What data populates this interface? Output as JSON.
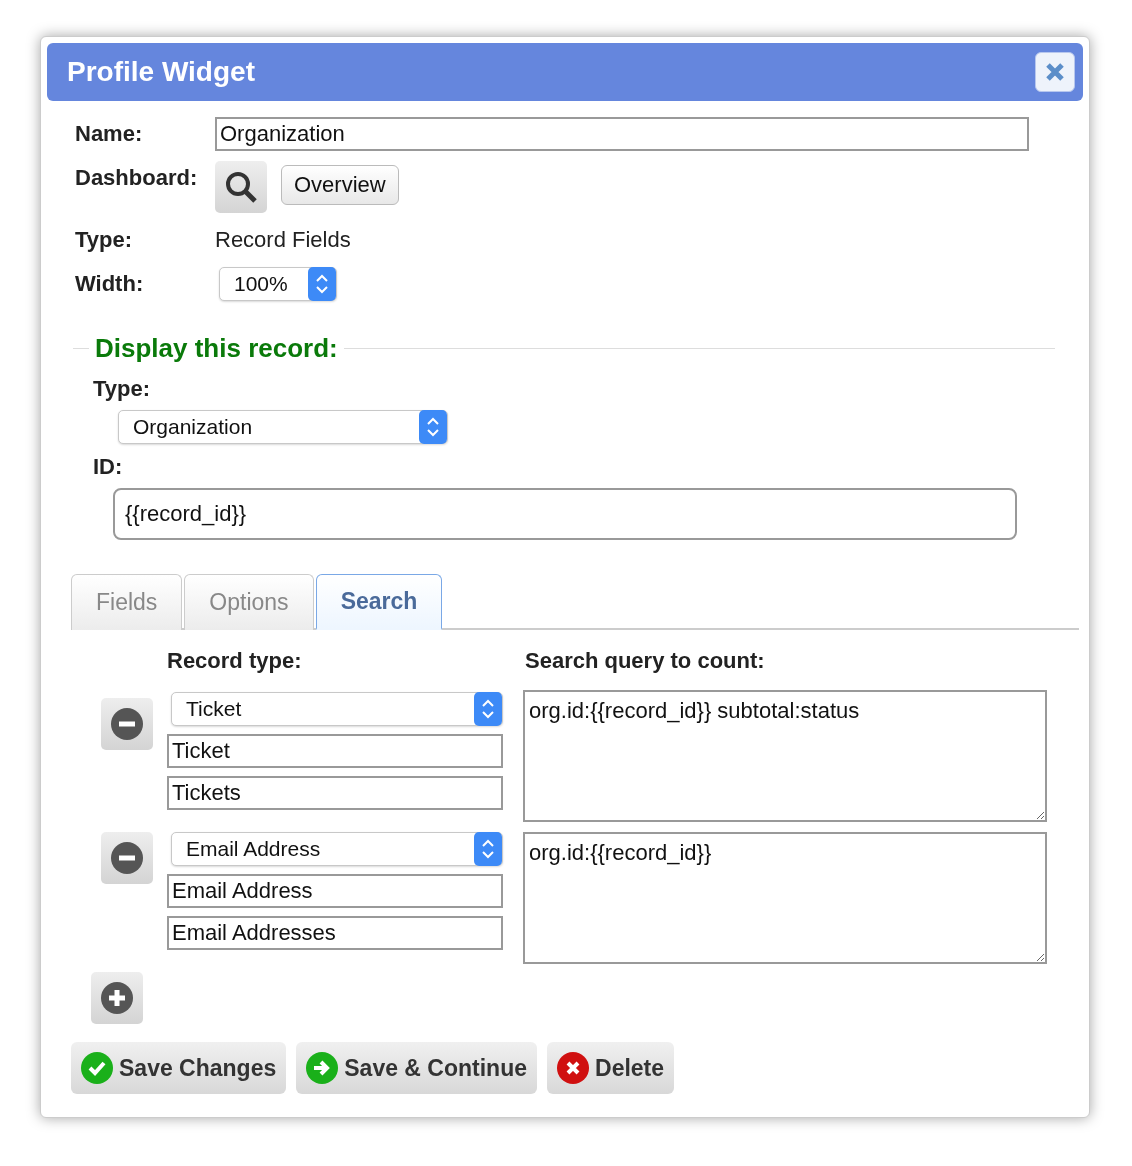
{
  "window": {
    "title": "Profile Widget"
  },
  "form": {
    "name_label": "Name:",
    "name_value": "Organization",
    "dashboard_label": "Dashboard:",
    "dashboard_button": "Overview",
    "type_label": "Type:",
    "type_value": "Record Fields",
    "width_label": "Width:",
    "width_value": "100%"
  },
  "display": {
    "legend": "Display this record:",
    "type_label": "Type:",
    "type_value": "Organization",
    "id_label": "ID:",
    "id_value": "{{record_id}}"
  },
  "tabs": [
    {
      "label": "Fields",
      "selected": false
    },
    {
      "label": "Options",
      "selected": false
    },
    {
      "label": "Search",
      "selected": true
    }
  ],
  "search": {
    "record_type_heading": "Record type:",
    "query_heading": "Search query to count:",
    "rows": [
      {
        "type": "Ticket",
        "singular": "Ticket",
        "plural": "Tickets",
        "query": "org.id:{{record_id}} subtotal:status"
      },
      {
        "type": "Email Address",
        "singular": "Email Address",
        "plural": "Email Addresses",
        "query": "org.id:{{record_id}}"
      }
    ]
  },
  "buttons": [
    {
      "label": "Save Changes",
      "kind": "save"
    },
    {
      "label": "Save & Continue",
      "kind": "continue"
    },
    {
      "label": "Delete",
      "kind": "delete"
    }
  ]
}
